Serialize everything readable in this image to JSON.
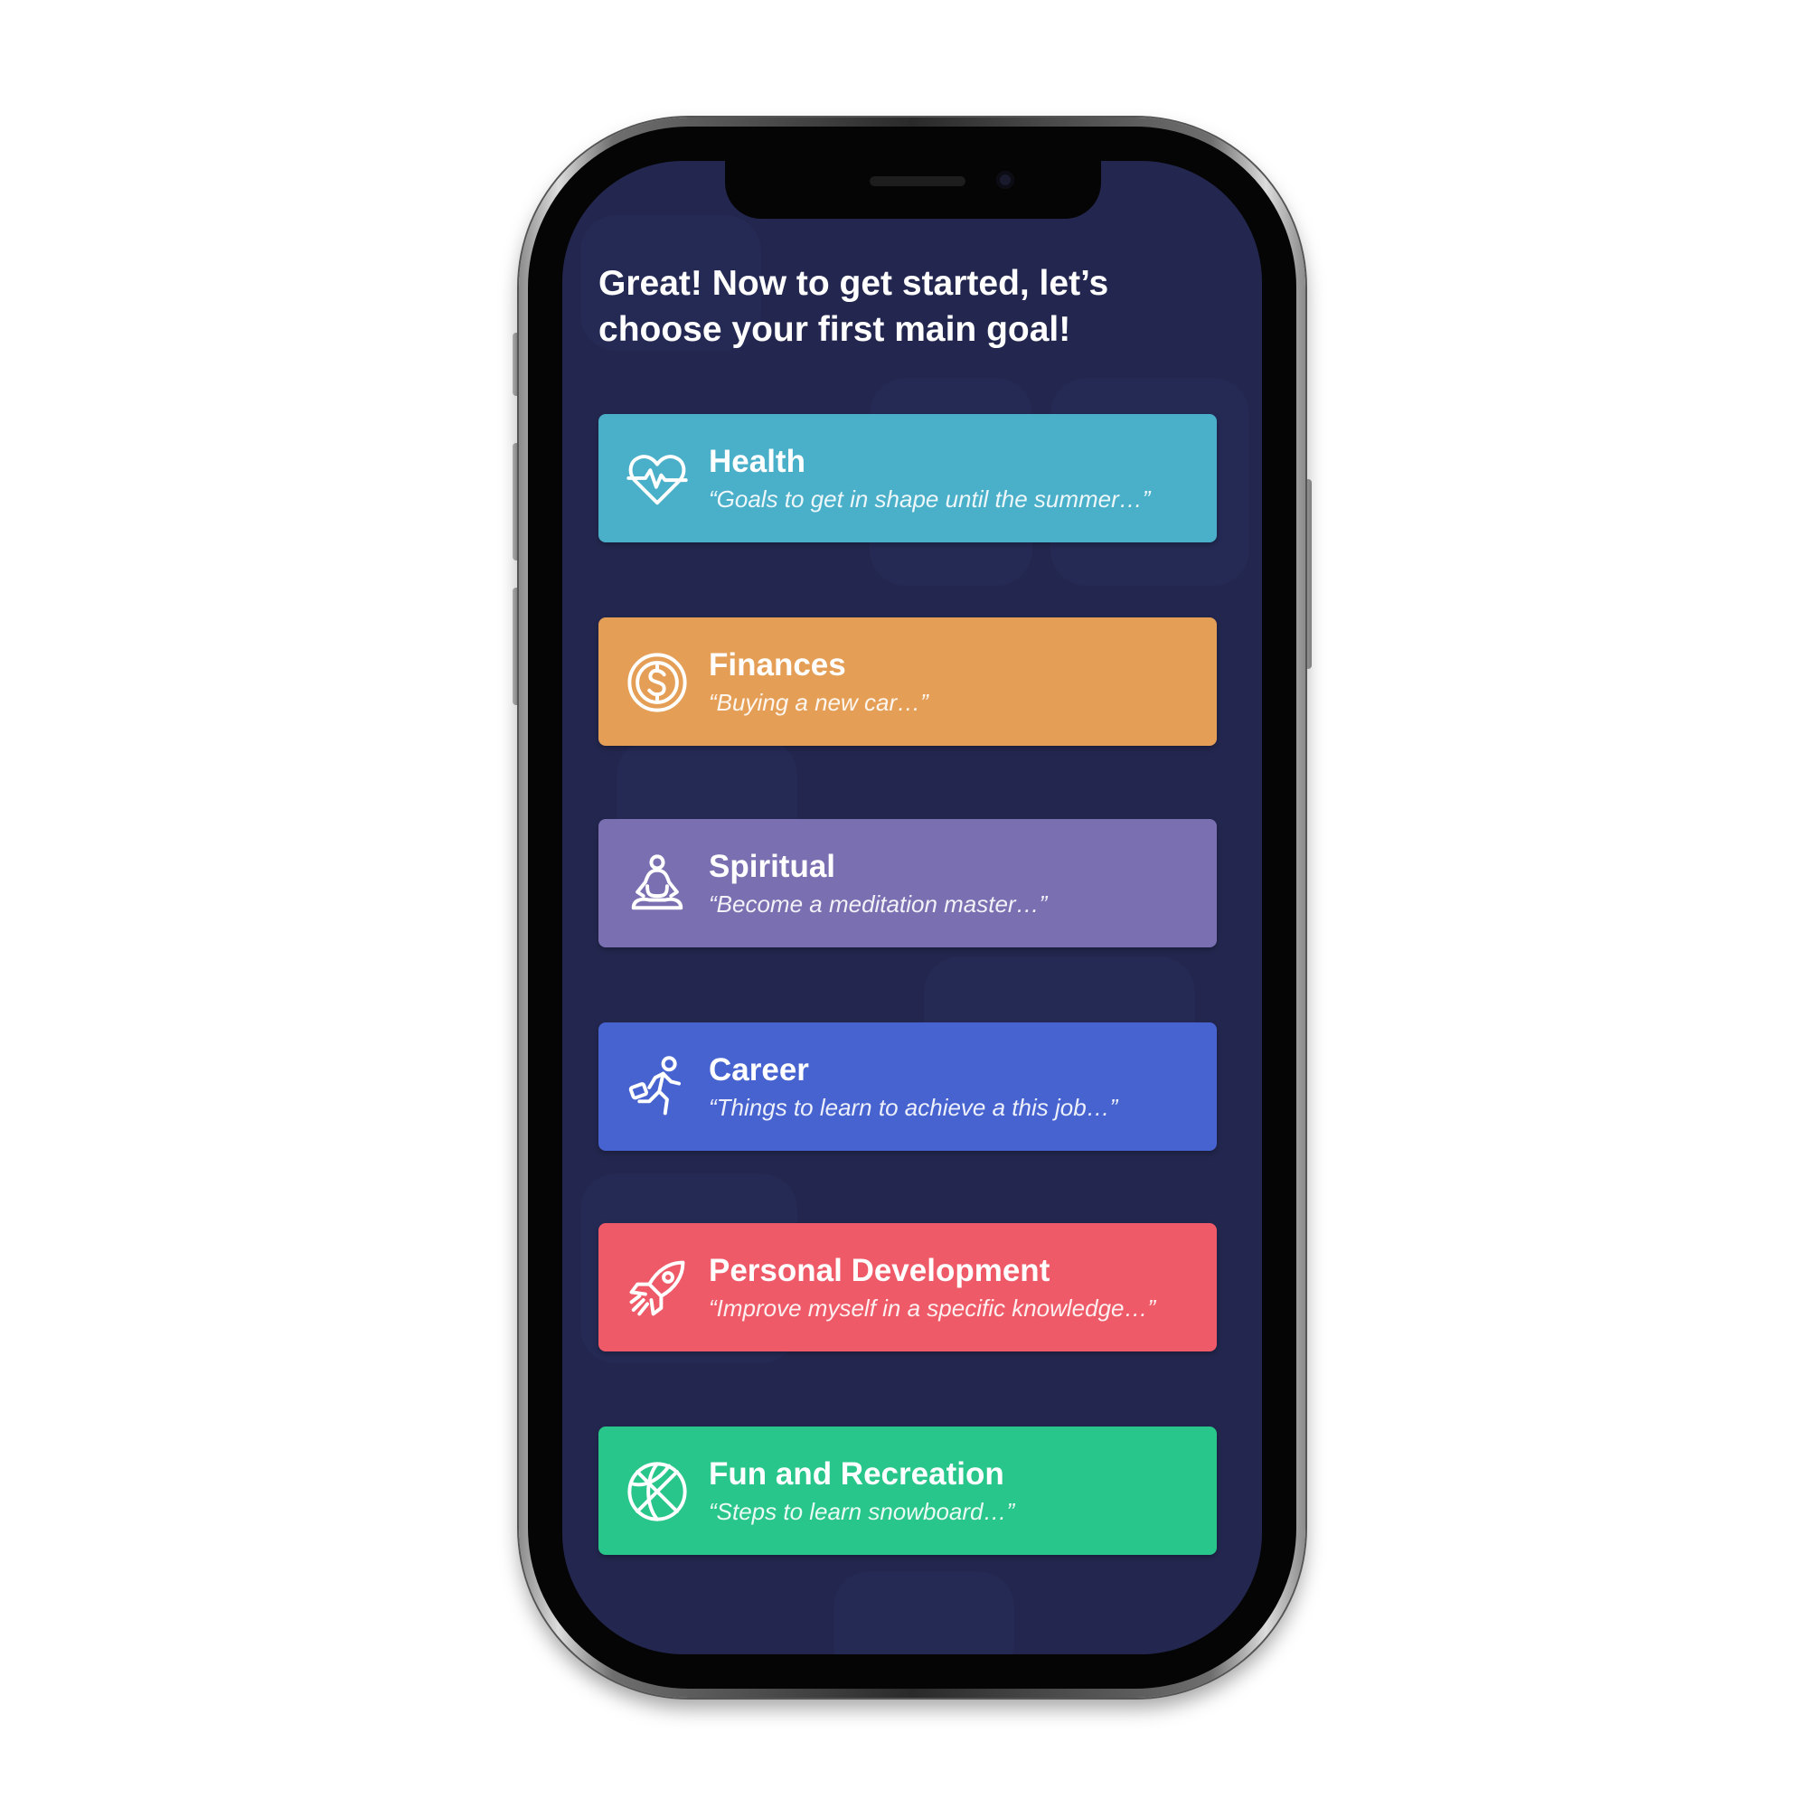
{
  "screen": {
    "headline": "Great! Now to get started, let’s choose your first main goal!"
  },
  "goals": [
    {
      "title": "Health",
      "subtitle": "“Goals to get in shape until the summer…”",
      "icon": "heart-pulse-icon",
      "color": "#4aafc9"
    },
    {
      "title": "Finances",
      "subtitle": "“Buying a new car…”",
      "icon": "dollar-coin-icon",
      "color": "#e59e55"
    },
    {
      "title": "Spiritual",
      "subtitle": "“Become a meditation master…”",
      "icon": "meditation-icon",
      "color": "#7a70b1"
    },
    {
      "title": "Career",
      "subtitle": "“Things to learn to achieve a this job…”",
      "icon": "running-businessman-icon",
      "color": "#4663d0"
    },
    {
      "title": "Personal Development",
      "subtitle": "“Improve myself in a specific knowledge…”",
      "icon": "rocket-icon",
      "color": "#ee5a67"
    },
    {
      "title": "Fun and Recreation",
      "subtitle": "“Steps to learn snowboard…”",
      "icon": "basketball-icon",
      "color": "#28c68b"
    }
  ]
}
